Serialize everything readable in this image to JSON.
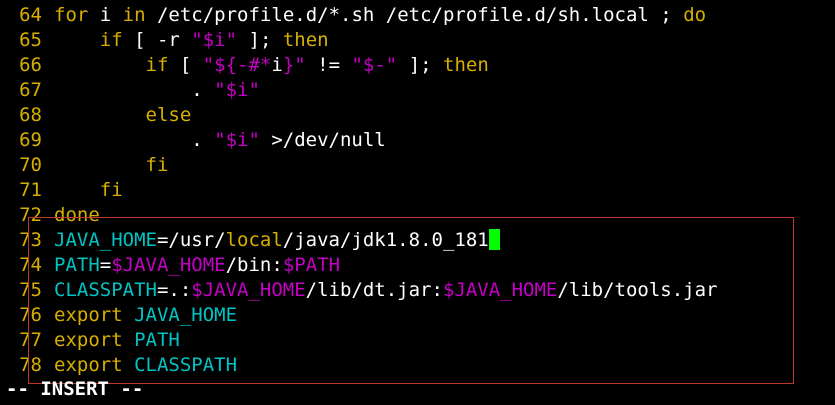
{
  "colors": {
    "background": "#000000",
    "line_number": "#d7af00",
    "keyword": "#d7af00",
    "string_var": "#c400c4",
    "identifier": "#00c4c4",
    "text": "#ffffff",
    "cursor": "#00ff00",
    "highlight_border": "#c0392b"
  },
  "status": "-- INSERT --",
  "lines": [
    {
      "n": "64",
      "tokens": [
        [
          "y",
          "for"
        ],
        [
          "w",
          " i "
        ],
        [
          "y",
          "in"
        ],
        [
          "w",
          " /etc/profile.d/*.sh /etc/profile.d/sh.local ; "
        ],
        [
          "y",
          "do"
        ]
      ]
    },
    {
      "n": "65",
      "tokens": [
        [
          "w",
          "    "
        ],
        [
          "y",
          "if"
        ],
        [
          "w",
          " [ -r "
        ],
        [
          "m",
          "\"$i\""
        ],
        [
          "w",
          " ]; "
        ],
        [
          "y",
          "then"
        ]
      ]
    },
    {
      "n": "66",
      "tokens": [
        [
          "w",
          "        "
        ],
        [
          "y",
          "if"
        ],
        [
          "w",
          " [ "
        ],
        [
          "m",
          "\"${-#*"
        ],
        [
          "w",
          "i"
        ],
        [
          "m",
          "}\""
        ],
        [
          "w",
          " != "
        ],
        [
          "m",
          "\"$-\""
        ],
        [
          "w",
          " ]; "
        ],
        [
          "y",
          "then"
        ]
      ]
    },
    {
      "n": "67",
      "tokens": [
        [
          "w",
          "            . "
        ],
        [
          "m",
          "\"$i\""
        ]
      ]
    },
    {
      "n": "68",
      "tokens": [
        [
          "w",
          "        "
        ],
        [
          "y",
          "else"
        ]
      ]
    },
    {
      "n": "69",
      "tokens": [
        [
          "w",
          "            . "
        ],
        [
          "m",
          "\"$i\""
        ],
        [
          "w",
          " >/dev/null"
        ]
      ]
    },
    {
      "n": "70",
      "tokens": [
        [
          "w",
          "        "
        ],
        [
          "y",
          "fi"
        ]
      ]
    },
    {
      "n": "71",
      "tokens": [
        [
          "w",
          "    "
        ],
        [
          "y",
          "fi"
        ]
      ]
    },
    {
      "n": "72",
      "tokens": [
        [
          "y",
          "done"
        ]
      ]
    },
    {
      "n": "73",
      "tokens": [
        [
          "c",
          "JAVA_HOME"
        ],
        [
          "w",
          "=/usr/"
        ],
        [
          "y",
          "local"
        ],
        [
          "w",
          "/java/jdk1.8.0_181"
        ]
      ],
      "cursor": true
    },
    {
      "n": "74",
      "tokens": [
        [
          "c",
          "PATH"
        ],
        [
          "w",
          "="
        ],
        [
          "m",
          "$JAVA_HOME"
        ],
        [
          "w",
          "/bin:"
        ],
        [
          "m",
          "$PATH"
        ]
      ]
    },
    {
      "n": "75",
      "tokens": [
        [
          "c",
          "CLASSPATH"
        ],
        [
          "w",
          "=.:"
        ],
        [
          "m",
          "$JAVA_HOME"
        ],
        [
          "w",
          "/lib/dt.jar:"
        ],
        [
          "m",
          "$JAVA_HOME"
        ],
        [
          "w",
          "/lib/tools.jar"
        ]
      ]
    },
    {
      "n": "76",
      "tokens": [
        [
          "y",
          "export"
        ],
        [
          "w",
          " "
        ],
        [
          "c",
          "JAVA_HOME"
        ]
      ]
    },
    {
      "n": "77",
      "tokens": [
        [
          "y",
          "export"
        ],
        [
          "w",
          " "
        ],
        [
          "c",
          "PATH"
        ]
      ]
    },
    {
      "n": "78",
      "tokens": [
        [
          "y",
          "export"
        ],
        [
          "w",
          " "
        ],
        [
          "c",
          "CLASSPATH"
        ]
      ]
    }
  ]
}
